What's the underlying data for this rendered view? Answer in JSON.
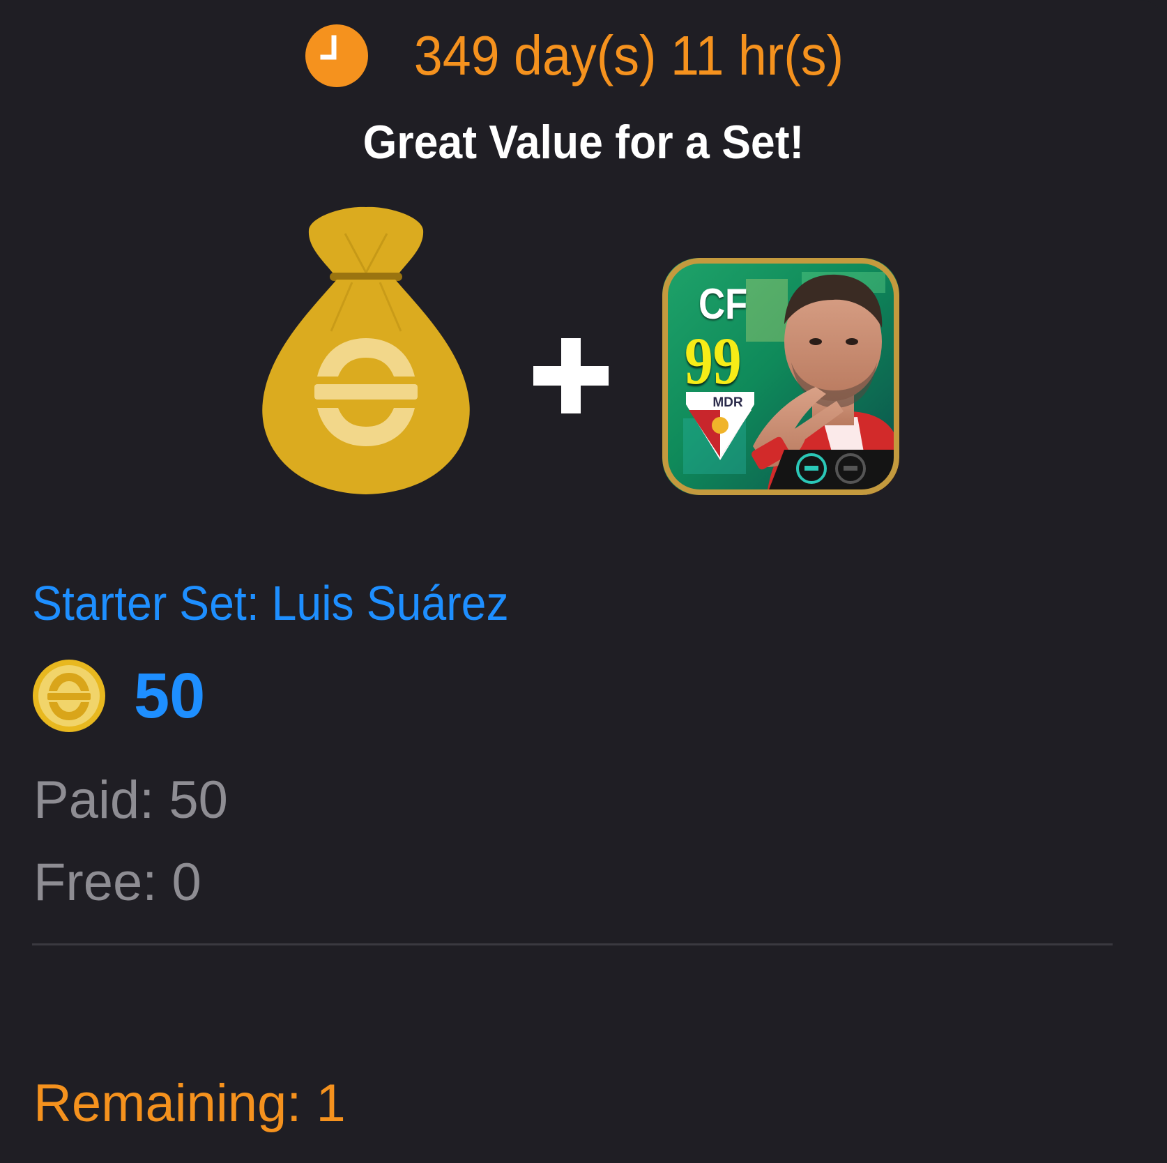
{
  "offer": {
    "timer_text": "349 day(s) 11 hr(s)",
    "headline": "Great Value for a Set!",
    "set_name": "Starter Set: Luis Suárez",
    "price": "50",
    "paid": "Paid: 50",
    "free": "Free: 0",
    "remaining": "Remaining: 1"
  },
  "bundle": {
    "items": [
      {
        "icon": "money-bag-icon"
      },
      {
        "icon": "plus-icon"
      },
      {
        "icon": "player-card"
      }
    ]
  },
  "player_card": {
    "position": "CF",
    "rating": "99",
    "club": "MDR"
  },
  "colors": {
    "background": "#1f1e24",
    "accent_orange": "#f5921e",
    "accent_blue": "#1e8fff",
    "muted_text": "#8e8d93",
    "bag_gold": "#dbab1f",
    "coin_gold": "#f1d46a"
  }
}
